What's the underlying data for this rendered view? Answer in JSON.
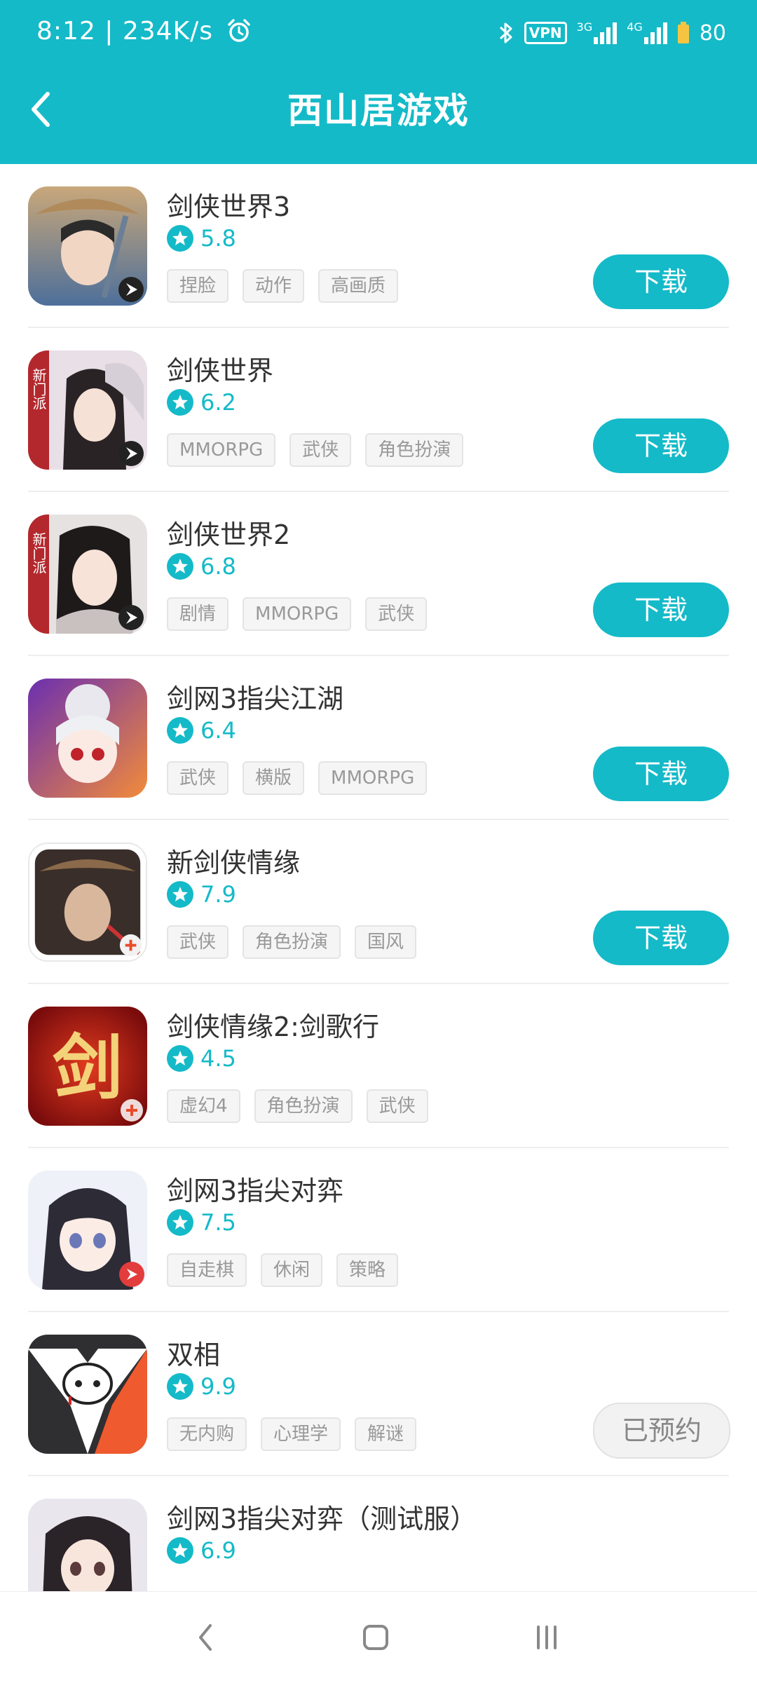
{
  "status_bar": {
    "time": "8:12 | 234K/s",
    "vpn": "VPN",
    "net1": "3G",
    "net2": "4G",
    "battery": "80"
  },
  "header": {
    "title": "西山居游戏"
  },
  "games": [
    {
      "name": "剑侠世界3",
      "rating": "5.8",
      "tags": [
        "捏脸",
        "动作",
        "高画质"
      ],
      "button": "下载"
    },
    {
      "name": "剑侠世界",
      "rating": "6.2",
      "tags": [
        "MMORPG",
        "武侠",
        "角色扮演"
      ],
      "button": "下载"
    },
    {
      "name": "剑侠世界2",
      "rating": "6.8",
      "tags": [
        "剧情",
        "MMORPG",
        "武侠"
      ],
      "button": "下载"
    },
    {
      "name": "剑网3指尖江湖",
      "rating": "6.4",
      "tags": [
        "武侠",
        "横版",
        "MMORPG"
      ],
      "button": "下载"
    },
    {
      "name": "新剑侠情缘",
      "rating": "7.9",
      "tags": [
        "武侠",
        "角色扮演",
        "国风"
      ],
      "button": "下载"
    },
    {
      "name": "剑侠情缘2:剑歌行",
      "rating": "4.5",
      "tags": [
        "虚幻4",
        "角色扮演",
        "武侠"
      ]
    },
    {
      "name": "剑网3指尖对弈",
      "rating": "7.5",
      "tags": [
        "自走棋",
        "休闲",
        "策略"
      ]
    },
    {
      "name": "双相",
      "rating": "9.9",
      "tags": [
        "无内购",
        "心理学",
        "解谜"
      ],
      "button": "已预约"
    },
    {
      "name": "剑网3指尖对弈（测试服）",
      "rating": "6.9",
      "tags": []
    }
  ],
  "icon_badges": {
    "new_sect": "新门派",
    "sword_char": "剑"
  },
  "colors": {
    "accent": "#14bac8",
    "tag_text": "#999999",
    "reserved_text": "#888888"
  }
}
